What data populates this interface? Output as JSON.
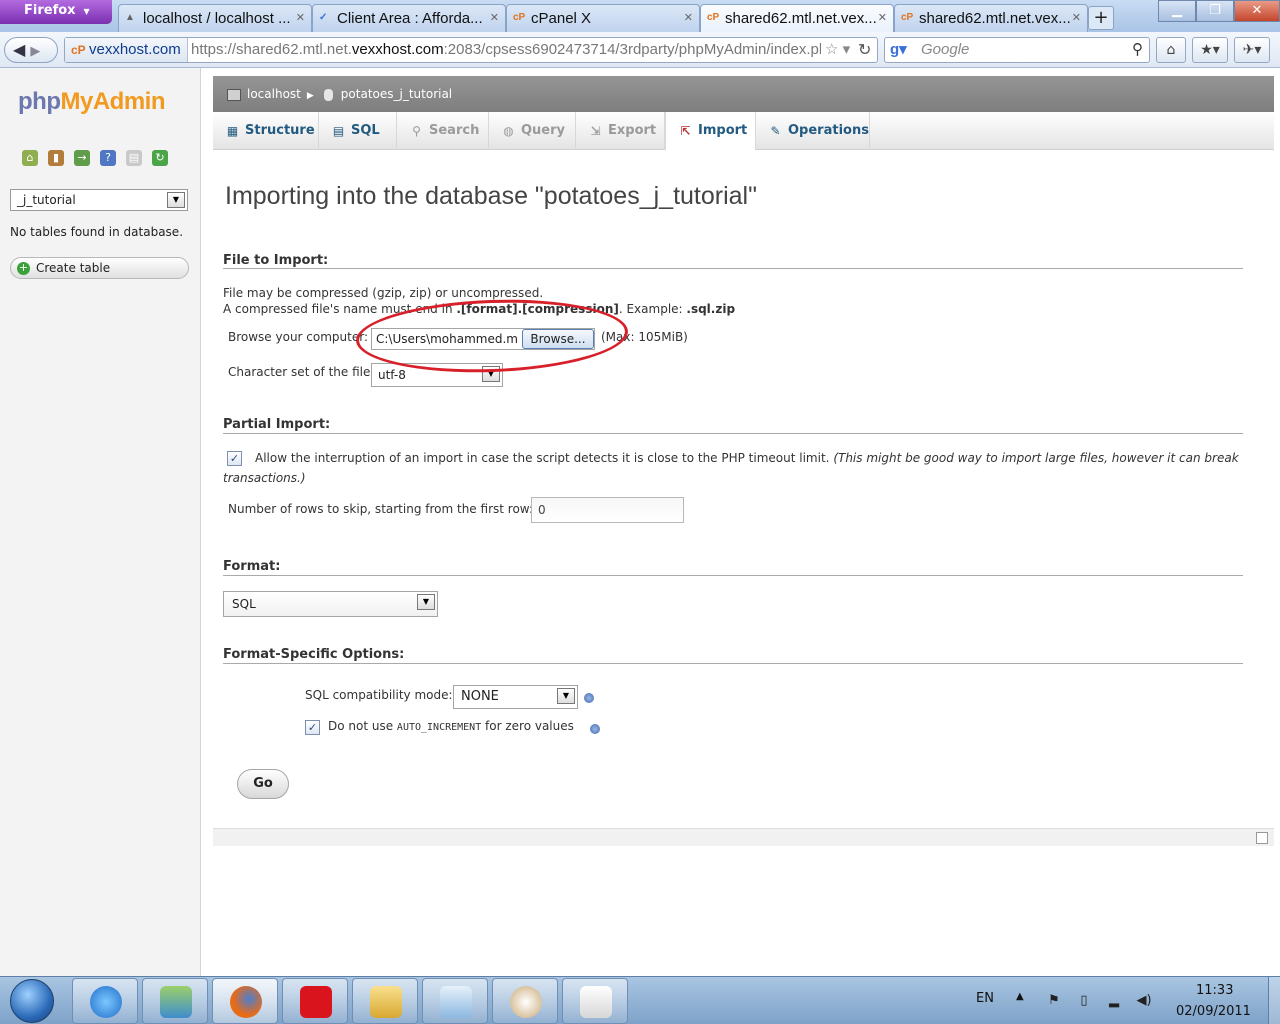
{
  "browser": {
    "menu_label": "Firefox",
    "tabs": [
      {
        "title": "localhost / localhost ...",
        "favicon": "pma-favicon"
      },
      {
        "title": "Client Area : Afforda...",
        "favicon": "vexxhost-favicon"
      },
      {
        "title": "cPanel X",
        "favicon": "cpanel-favicon"
      },
      {
        "title": "shared62.mtl.net.vex...",
        "favicon": "cpanel-favicon",
        "active": true
      },
      {
        "title": "shared62.mtl.net.vex...",
        "favicon": "cpanel-favicon"
      }
    ],
    "site_identity": "vexxhost.com",
    "url_prefix": "https://shared62.mtl.net.",
    "url_host": "vexxhost.com",
    "url_rest": ":2083/cpsess6902473714/3rdparty/phpMyAdmin/index.pl",
    "search_engine": "Google",
    "search_placeholder": "Google"
  },
  "sidebar": {
    "logo_php": "php",
    "logo_myadmin": "MyAdmin",
    "icons": [
      "home-icon",
      "server-icon",
      "logout-icon",
      "help-icon",
      "docs-icon",
      "reload-icon"
    ],
    "db_select_value": "_j_tutorial",
    "no_tables_text": "No tables found in database.",
    "create_table_label": "Create table"
  },
  "breadcrumb": {
    "server": "localhost",
    "database": "potatoes_j_tutorial"
  },
  "menu": {
    "tabs": [
      {
        "label": "Structure",
        "icon": "structure-icon"
      },
      {
        "label": "SQL",
        "icon": "sql-icon"
      },
      {
        "label": "Search",
        "icon": "search-icon",
        "disabled": true
      },
      {
        "label": "Query",
        "icon": "query-icon",
        "disabled": true
      },
      {
        "label": "Export",
        "icon": "export-icon",
        "disabled": true
      },
      {
        "label": "Import",
        "icon": "import-icon",
        "active": true
      },
      {
        "label": "Operations",
        "icon": "operations-icon"
      }
    ]
  },
  "main": {
    "heading": "Importing into the database \"potatoes_j_tutorial\"",
    "file_section": {
      "title": "File to Import:",
      "note_line1": "File may be compressed (gzip, zip) or uncompressed.",
      "note_line2_start": "A compressed file's name must end in ",
      "note_line2_bold": ".[format].[compression]",
      "note_line2_mid": ". Example: ",
      "note_line2_example": ".sql.zip",
      "browse_label": "Browse your computer:",
      "file_value": "C:\\Users\\mohammed.m",
      "browse_button": "Browse...",
      "max_size": "(Max: 105MiB)",
      "charset_label": "Character set of the file:",
      "charset_value": "utf-8"
    },
    "partial_section": {
      "title": "Partial Import:",
      "allow_interrupt_label": "Allow the interruption of an import in case the script detects it is close to the PHP timeout limit.",
      "allow_interrupt_note_a": "(This might be good way to import large files, however it can break",
      "allow_interrupt_note_b": "transactions.)",
      "allow_interrupt_checked": true,
      "skip_label": "Number of rows to skip, starting from the first row:",
      "skip_value": "0"
    },
    "format_section": {
      "title": "Format:",
      "format_value": "SQL"
    },
    "format_options_section": {
      "title": "Format-Specific Options:",
      "compat_label": "SQL compatibility mode:",
      "compat_value": "NONE",
      "auto_inc_prefix": "Do not use ",
      "auto_inc_code": "AUTO_INCREMENT",
      "auto_inc_suffix": " for zero values",
      "auto_inc_checked": true
    },
    "go_button": "Go"
  },
  "taskbar": {
    "apps": [
      "internet-explorer-icon",
      "users-icon",
      "firefox-icon",
      "vodafone-icon",
      "folder-icon",
      "notepad-icon",
      "paint-icon",
      "wordpad-icon"
    ],
    "language": "EN",
    "time": "11:33",
    "date": "02/09/2011"
  },
  "colors": {
    "pma_header_gray": "#8a8a8a",
    "pma_link_blue": "#235a81",
    "annotation_red": "#d8202a",
    "firefox_purple": "#8a3ec0"
  }
}
